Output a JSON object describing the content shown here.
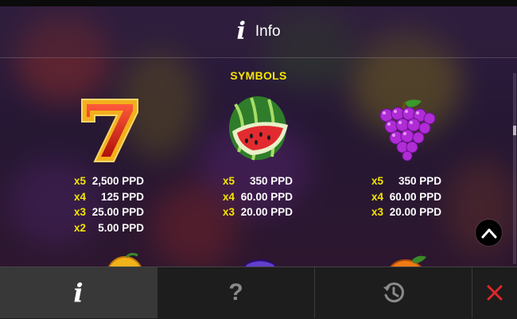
{
  "header": {
    "title": "Info"
  },
  "section": {
    "title": "SYMBOLS"
  },
  "symbols": [
    {
      "icon": "seven-icon",
      "pays": [
        {
          "mult": "x5",
          "value": "2,500 PPD"
        },
        {
          "mult": "x4",
          "value": "125 PPD"
        },
        {
          "mult": "x3",
          "value": "25.00 PPD"
        },
        {
          "mult": "x2",
          "value": "5.00 PPD"
        }
      ]
    },
    {
      "icon": "watermelon-icon",
      "pays": [
        {
          "mult": "x5",
          "value": "350 PPD"
        },
        {
          "mult": "x4",
          "value": "60.00 PPD"
        },
        {
          "mult": "x3",
          "value": "20.00 PPD"
        }
      ]
    },
    {
      "icon": "grapes-icon",
      "pays": [
        {
          "mult": "x5",
          "value": "350 PPD"
        },
        {
          "mult": "x4",
          "value": "60.00 PPD"
        },
        {
          "mult": "x3",
          "value": "20.00 PPD"
        }
      ]
    }
  ],
  "bottom_tabs": [
    {
      "icon": "info-icon",
      "active": true
    },
    {
      "icon": "help-icon",
      "active": false
    },
    {
      "icon": "history-icon",
      "active": false
    },
    {
      "icon": "close-icon",
      "active": false
    }
  ],
  "colors": {
    "accent_yellow": "#f6e600",
    "close_red": "#e0262a"
  }
}
